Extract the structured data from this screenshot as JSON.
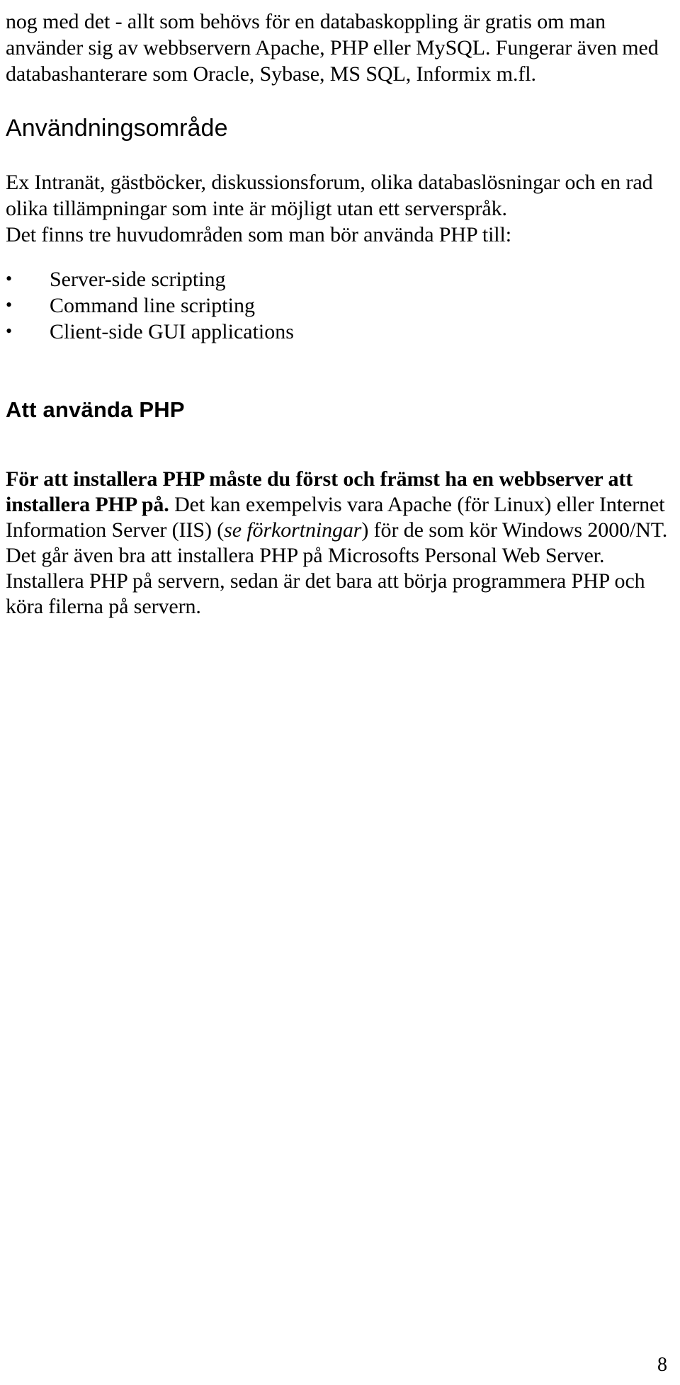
{
  "document": {
    "page_number": "8",
    "language": "sv",
    "intro_paragraph": {
      "line1": "nog med det - allt som behövs för en databaskoppling är gratis om man",
      "line2": "använder sig av webbservern Apache, PHP eller MySQL. Fungerar även",
      "line3": "med databashanterare som Oracle, Sybase, MS SQL, Informix m.fl."
    },
    "section_usage": {
      "heading": "Användningsområde",
      "paragraph_line1": "Ex Intranät, gästböcker, diskussionsforum, olika databaslösningar och en",
      "paragraph_line2": "rad olika tillämpningar som inte är möjligt utan ett serverspråk.",
      "lead_in": "Det finns tre huvudområden som man bör använda PHP till:",
      "bullets": [
        "Server-side scripting",
        "Command line scripting",
        "Client-side GUI applications"
      ]
    },
    "section_using_php": {
      "heading": "Att använda PHP",
      "body": {
        "bold_run_1": "För att installera PHP måste du först och främst ha en webbserver att installera PHP på.",
        "normal_run_1": " Det kan exempelvis vara Apache (för Linux) eller Internet Information Server (IIS) (",
        "italic_run_1": "se förkortningar",
        "normal_run_2": ") för de som kör Windows 2000/NT. Det går även bra att installera PHP på Microsofts Personal Web Server.",
        "normal_run_3": "Installera PHP på servern, sedan är det bara att börja programmera PHP och köra filerna på servern."
      }
    }
  }
}
